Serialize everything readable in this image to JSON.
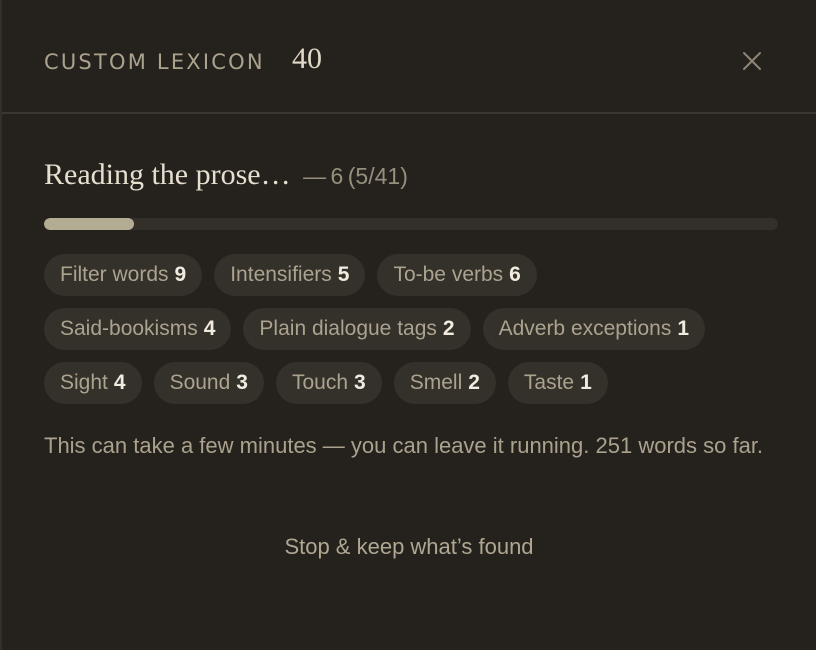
{
  "header": {
    "title": "CUSTOM LEXICON",
    "count": "40"
  },
  "status": {
    "message": "Reading the prose…",
    "separator": "—",
    "found": "6",
    "progress_text": "(5/41)",
    "progress_fraction": 0.122
  },
  "chips": [
    [
      {
        "label": "Filter words",
        "count": "9"
      },
      {
        "label": "Intensifiers",
        "count": "5"
      },
      {
        "label": "To-be verbs",
        "count": "6"
      }
    ],
    [
      {
        "label": "Said-bookisms",
        "count": "4"
      },
      {
        "label": "Plain dialogue tags",
        "count": "2"
      },
      {
        "label": "Adverb exceptions",
        "count": "1"
      }
    ],
    [
      {
        "label": "Sight",
        "count": "4"
      },
      {
        "label": "Sound",
        "count": "3"
      },
      {
        "label": "Touch",
        "count": "3"
      },
      {
        "label": "Smell",
        "count": "2"
      },
      {
        "label": "Taste",
        "count": "1"
      }
    ]
  ],
  "note": "This can take a few minutes — you can leave it running. 251 words so far.",
  "actions": {
    "stop_label": "Stop & keep what’s found"
  },
  "icons": {
    "close": "close-icon"
  },
  "colors": {
    "background": "#25221e",
    "accent": "#b4ab93",
    "text_muted": "#aba28e",
    "text_bright": "#e6dfd0"
  }
}
